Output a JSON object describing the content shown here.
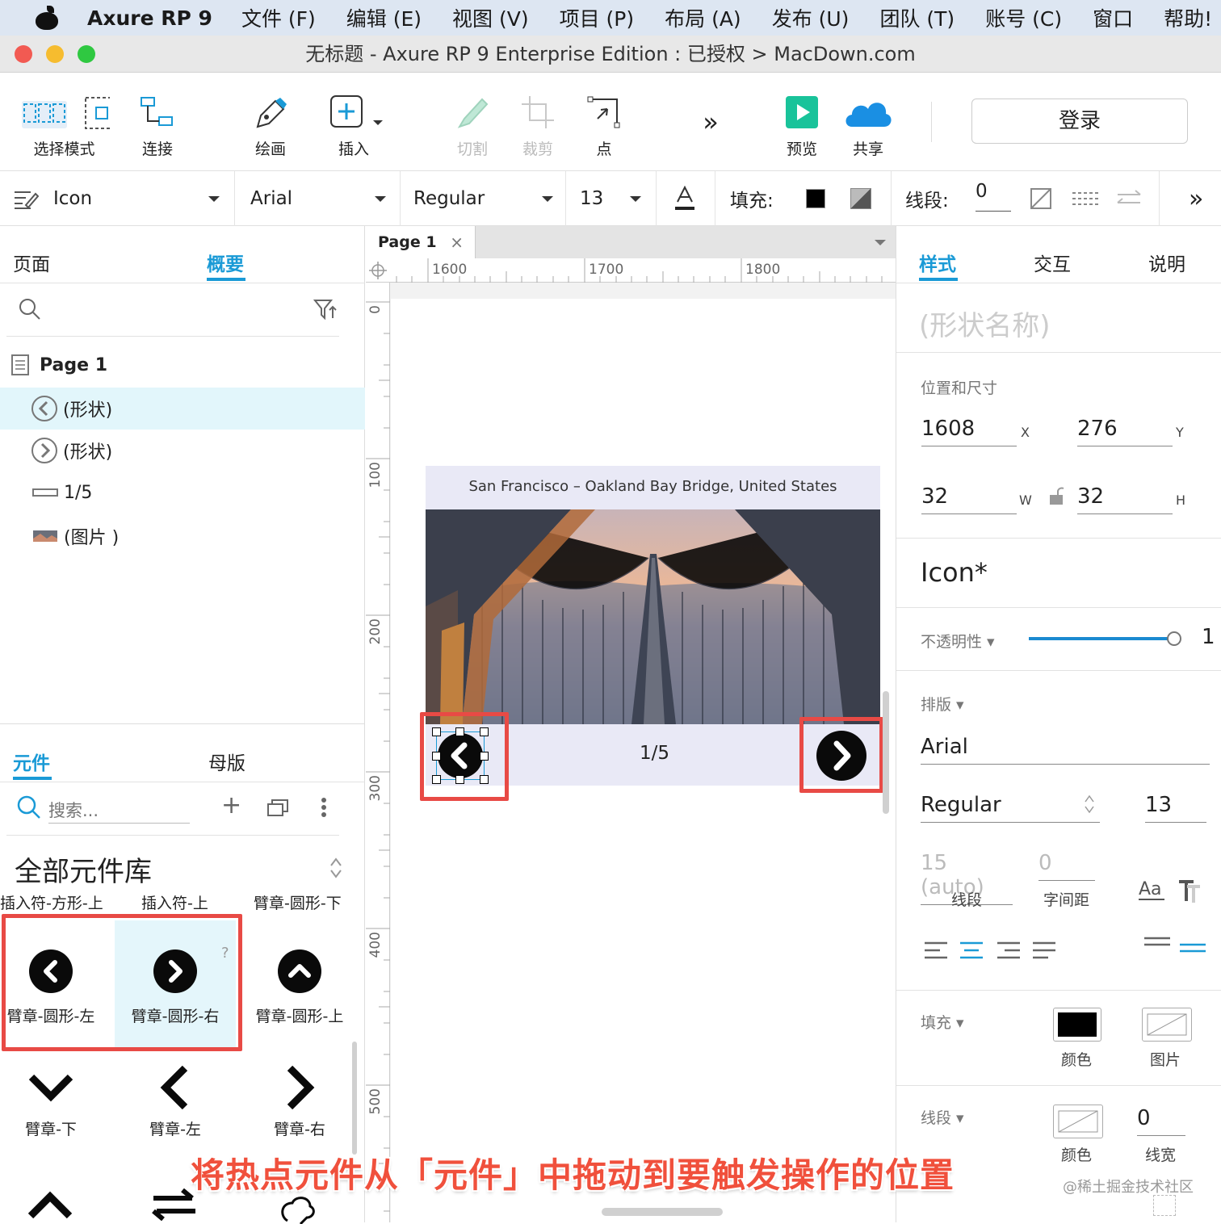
{
  "menubar": {
    "app": "Axure RP 9",
    "items": [
      "文件 (F)",
      "编辑 (E)",
      "视图 (V)",
      "项目 (P)",
      "布局 (A)",
      "发布 (U)",
      "团队 (T)",
      "账号 (C)",
      "窗口",
      "帮助!"
    ]
  },
  "window": {
    "title": "无标题 - Axure RP 9 Enterprise Edition : 已授权 > MacDown.com"
  },
  "toolbar": {
    "select": "选择模式",
    "connect": "连接",
    "draw": "绘画",
    "insert": "插入",
    "cut": "切割",
    "crop": "裁剪",
    "point": "点",
    "more": "»",
    "preview": "预览",
    "share": "共享",
    "login": "登录"
  },
  "format": {
    "style": "Icon",
    "font": "Arial",
    "weight": "Regular",
    "size": "13",
    "fill_label": "填充:",
    "stroke_label": "线段:",
    "stroke_value": "0"
  },
  "left": {
    "tabs": [
      "页面",
      "概要"
    ],
    "tree": [
      {
        "label": "Page 1"
      },
      {
        "label": "(形状)"
      },
      {
        "label": "(形状)"
      },
      {
        "label": "1/5"
      },
      {
        "label": "(图片 )"
      }
    ],
    "lib_tabs": [
      "元件",
      "母版"
    ],
    "search_placeholder": "搜索...",
    "library": "全部元件库",
    "row_labels": [
      "插入符-方形-上",
      "插入符-上",
      "臂章-圆形-下"
    ],
    "components": [
      "臂章-圆形-左",
      "臂章-圆形-右",
      "臂章-圆形-上",
      "臂章-下",
      "臂章-左",
      "臂章-右"
    ]
  },
  "canvas": {
    "tab": "Page 1",
    "ruler_h": [
      "1600",
      "1700",
      "1800"
    ],
    "ruler_v": [
      "0",
      "100",
      "200",
      "300",
      "400",
      "500"
    ],
    "slide_caption": "San Francisco – Oakland Bay Bridge, United States",
    "counter": "1/5"
  },
  "right": {
    "tabs": [
      "样式",
      "交互",
      "说明"
    ],
    "shape_name": "(形状名称)",
    "pos_size": "位置和尺寸",
    "x": "1608",
    "x_label": "X",
    "y": "276",
    "y_label": "Y",
    "w": "32",
    "w_label": "W",
    "h": "32",
    "h_label": "H",
    "style_name": "Icon*",
    "opacity_label": "不透明性 ▾",
    "opacity_value": 1.0,
    "opacity_text": "1",
    "typography": "排版 ▾",
    "font": "Arial",
    "weight": "Regular",
    "size": "13",
    "line_spacing": "15 (auto)",
    "line_label": "线段",
    "char_spacing": "0",
    "char_label": "字间距",
    "fill": "填充 ▾",
    "fill_color": "颜色",
    "fill_image": "图片",
    "stroke": "线段 ▾",
    "stroke_color": "颜色",
    "stroke_width": "0",
    "stroke_width_label": "线宽"
  },
  "caption": "将热点元件从「元件」中拖动到要触发操作的位置",
  "watermark": "@稀土掘金技术社区",
  "colors": {
    "accent": "#1a9ad6",
    "highlight": "#e84a45"
  }
}
